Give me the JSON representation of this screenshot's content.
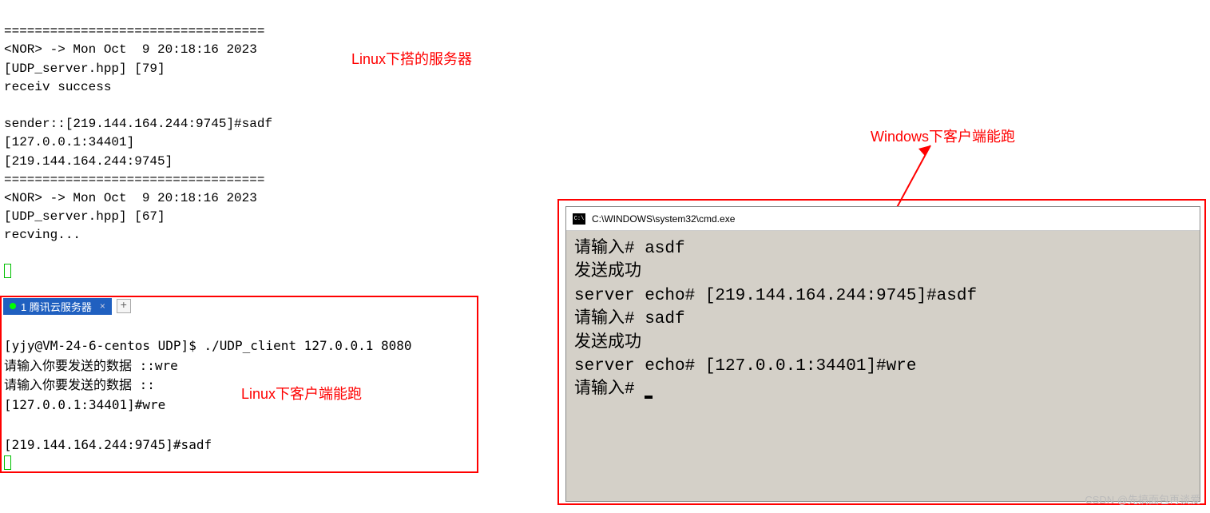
{
  "server_terminal": {
    "lines": [
      "==================================",
      "<NOR> -> Mon Oct  9 20:18:16 2023",
      "[UDP_server.hpp] [79]",
      "receiv success",
      "",
      "sender::[219.144.164.244:9745]#sadf",
      "[127.0.0.1:34401]",
      "[219.144.164.244:9745]",
      "==================================",
      "<NOR> -> Mon Oct  9 20:18:16 2023",
      "[UDP_server.hpp] [67]",
      "recving..."
    ]
  },
  "tab": {
    "label": "1 腾讯云服务器",
    "close": "×",
    "plus": "+"
  },
  "client_terminal": {
    "lines": [
      "[yjy@VM-24-6-centos UDP]$ ./UDP_client 127.0.0.1 8080",
      "请输入你要发送的数据 ::wre",
      "请输入你要发送的数据 ::",
      "[127.0.0.1:34401]#wre",
      "",
      "[219.144.164.244:9745]#sadf"
    ]
  },
  "cmd_window": {
    "title": "C:\\WINDOWS\\system32\\cmd.exe",
    "lines": [
      "请输入# asdf",
      "发送成功",
      "server echo# [219.144.164.244:9745]#asdf",
      "请输入# sadf",
      "发送成功",
      "server echo# [127.0.0.1:34401]#wre",
      "请输入# "
    ]
  },
  "annotations": {
    "linux_server": "Linux下搭的服务器",
    "windows_client": "Windows下客户端能跑",
    "linux_client": "Linux下客户端能跑"
  },
  "watermark": "CSDN @先搞面包再谈爱",
  "colors": {
    "annotation": "#ff0000",
    "tab_bg": "#2060c0",
    "cmd_bg": "#d4d0c8"
  }
}
